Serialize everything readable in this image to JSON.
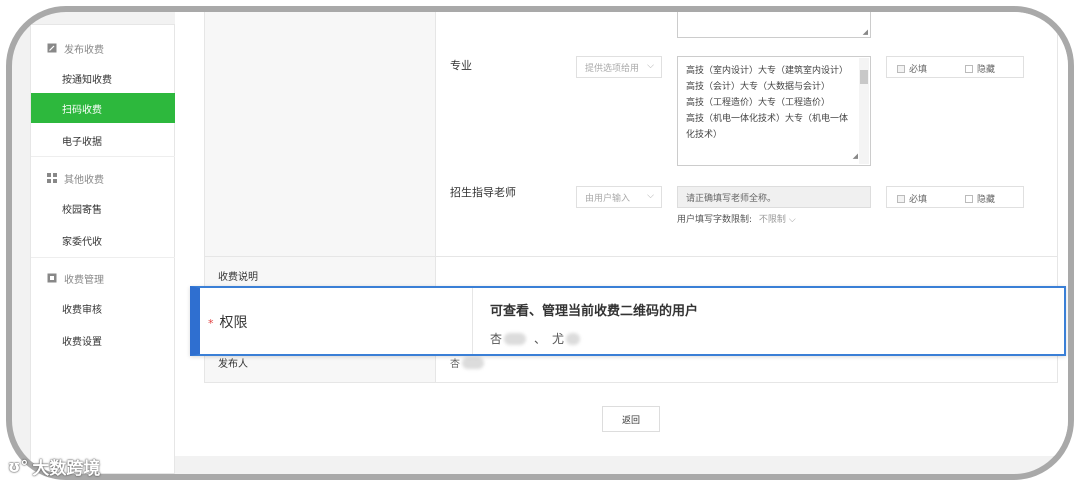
{
  "sidebar": {
    "groups": [
      {
        "label": "发布收费",
        "icon": "edit-icon"
      },
      {
        "label": "其他收费",
        "icon": "grid-icon"
      },
      {
        "label": "收费管理",
        "icon": "manage-icon"
      }
    ],
    "items": [
      {
        "label": "按通知收费"
      },
      {
        "label": "扫码收费",
        "active": true
      },
      {
        "label": "电子收据"
      },
      {
        "label": "校园寄售"
      },
      {
        "label": "家委代收"
      },
      {
        "label": "收费审核"
      },
      {
        "label": "收费设置"
      }
    ]
  },
  "form": {
    "major": {
      "label": "专业",
      "source_select": "提供选项给用",
      "options": [
        "高技（室内设计）大专（建筑室内设计）",
        "高技（会计）大专（大数据与会计）",
        "高技（工程造价）大专（工程造价）",
        "高技（机电一体化技术）大专（机电一体化技术）"
      ],
      "required_label": "必填",
      "hidden_label": "隐藏"
    },
    "teacher": {
      "label": "招生指导老师",
      "source_select": "由用户输入",
      "input_value": "请正确填写老师全称。",
      "limit_label": "用户填写字数限制:",
      "limit_value": "不限制",
      "required_label": "必填",
      "hidden_label": "隐藏"
    },
    "fee_description_label": "收费说明",
    "publisher_label": "发布人",
    "publisher_value": "杏"
  },
  "permission": {
    "label": "权限",
    "title": "可查看、管理当前收费二维码的用户",
    "user_prefix_1": "杏",
    "separator": "、",
    "user_prefix_2": "尤"
  },
  "back_button": "返回",
  "watermark": "大数跨境",
  "colors": {
    "active_green": "#2db83d",
    "highlight_blue": "#2f6fd0"
  }
}
